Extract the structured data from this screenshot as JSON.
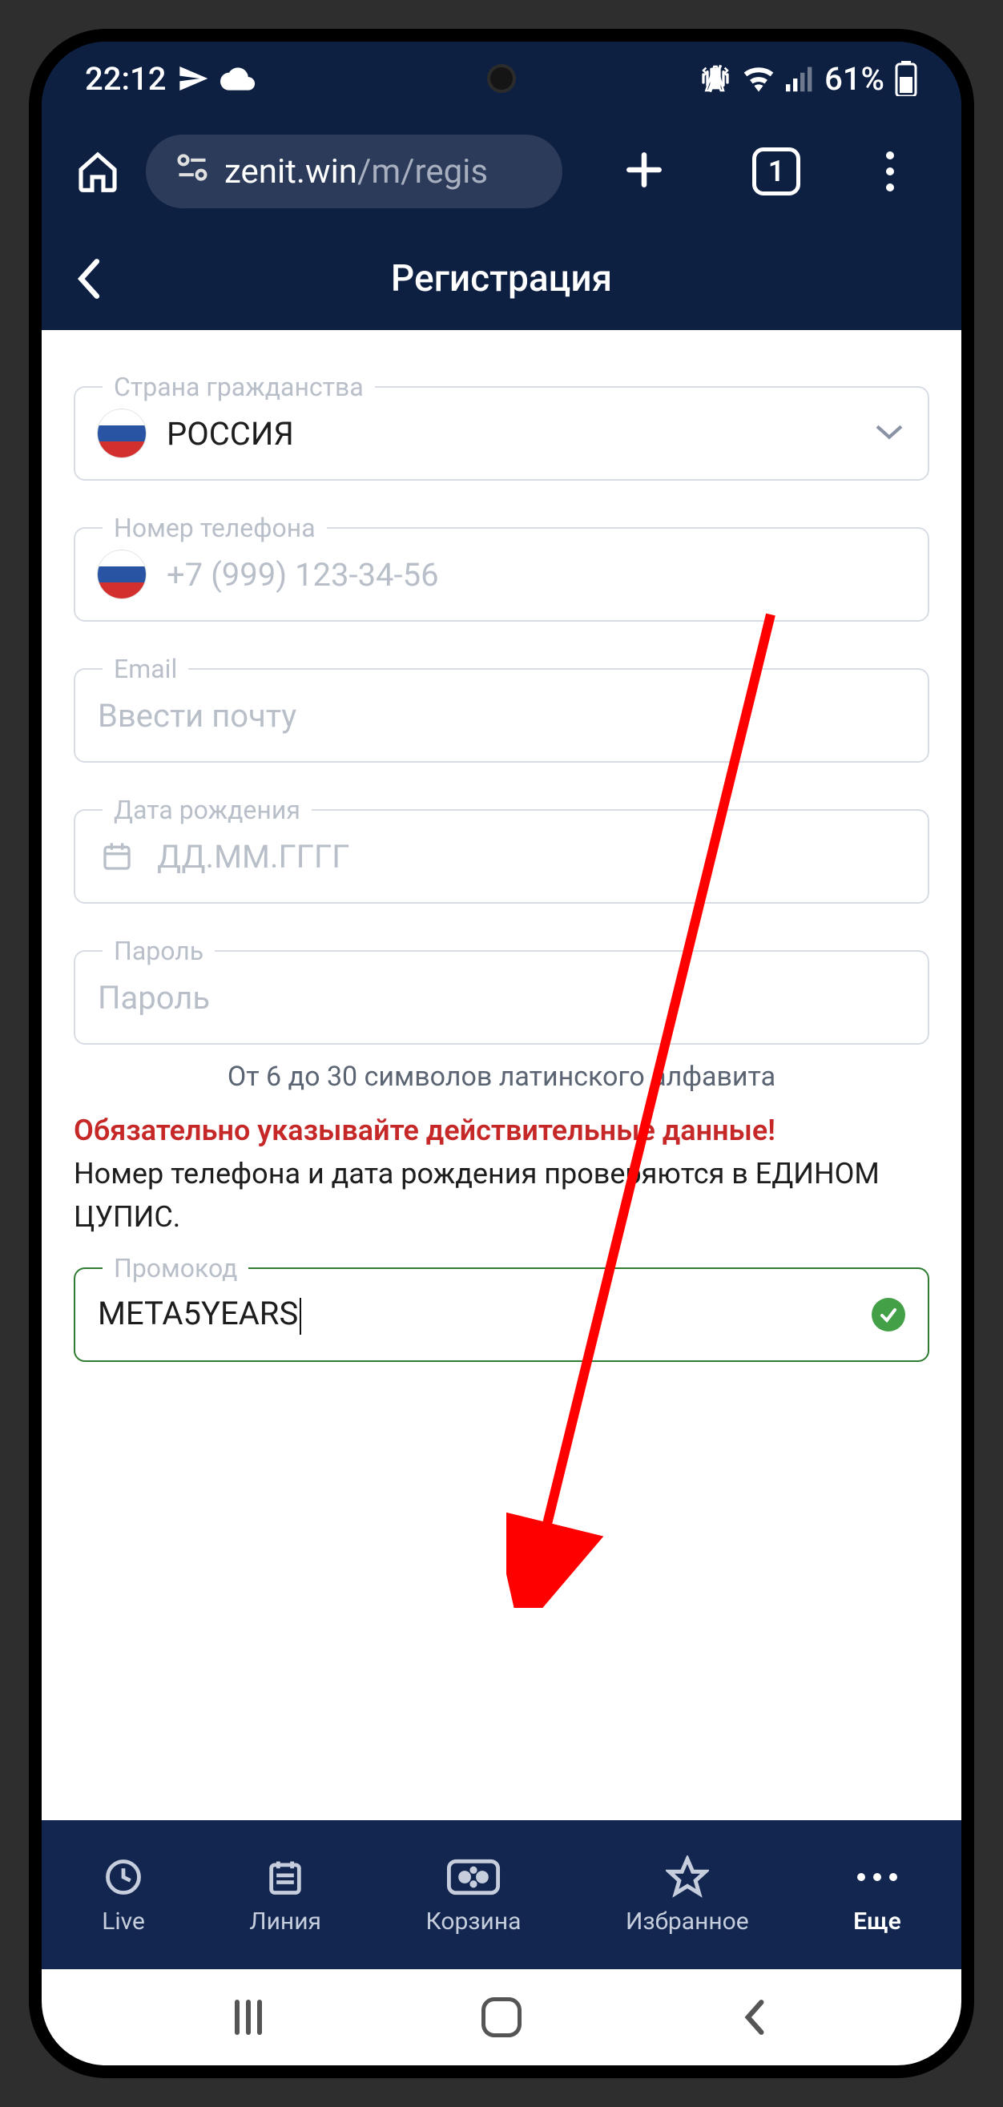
{
  "status": {
    "time": "22:12",
    "battery": "61%"
  },
  "browser": {
    "url_domain": "zenit.win",
    "url_path": "/m/regis",
    "tab_count": "1"
  },
  "header": {
    "title": "Регистрация"
  },
  "form": {
    "country": {
      "label": "Страна гражданства",
      "value": "РОССИЯ"
    },
    "phone": {
      "label": "Номер телефона",
      "placeholder": "+7 (999) 123-34-56"
    },
    "email": {
      "label": "Email",
      "placeholder": "Ввести почту"
    },
    "dob": {
      "label": "Дата рождения",
      "placeholder": "ДД.ММ.ГГГГ"
    },
    "password": {
      "label": "Пароль",
      "placeholder": "Пароль",
      "hint": "От 6 до 30 символов латинского алфавита"
    },
    "warning_title": "Обязательно указывайте действительные данные!",
    "warning_sub": "Номер телефона и дата рождения проверяются в ЕДИНОМ ЦУПИС.",
    "promo": {
      "label": "Промокод",
      "value": "META5YEARS"
    }
  },
  "nav": {
    "live": "Live",
    "line": "Линия",
    "basket": "Корзина",
    "fav": "Избранное",
    "more": "Еще"
  }
}
